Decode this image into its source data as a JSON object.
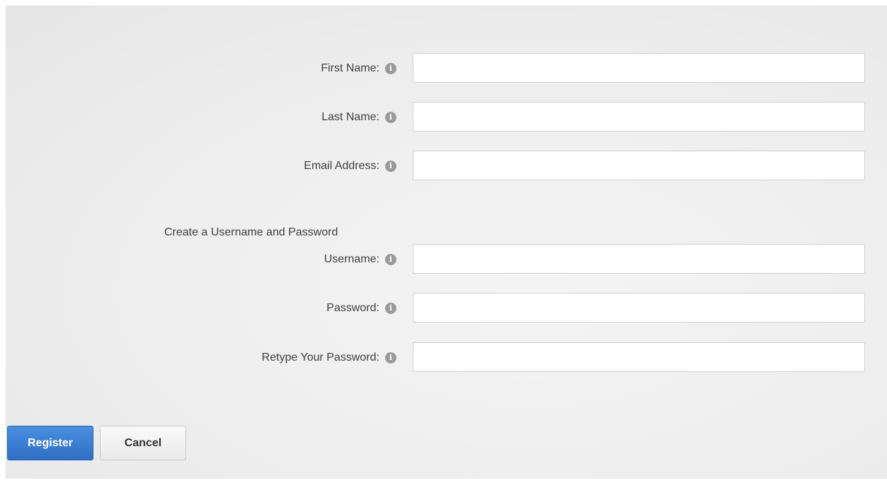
{
  "form": {
    "fields": [
      {
        "label": "First Name:",
        "value": "",
        "placeholder": ""
      },
      {
        "label": "Last Name:",
        "value": "",
        "placeholder": ""
      },
      {
        "label": "Email Address:",
        "value": "",
        "placeholder": ""
      },
      {
        "label": "Username:",
        "value": "",
        "placeholder": ""
      },
      {
        "label": "Password:",
        "value": "",
        "placeholder": ""
      },
      {
        "label": "Retype Your Password:",
        "value": "",
        "placeholder": ""
      }
    ],
    "section_heading": "Create a Username and Password",
    "info_icon_glyph": "i"
  },
  "actions": {
    "register_label": "Register",
    "cancel_label": "Cancel"
  },
  "colors": {
    "primary_button": "#2f6fc4",
    "info_icon": "#9a9a9a",
    "label_text": "#404040"
  }
}
